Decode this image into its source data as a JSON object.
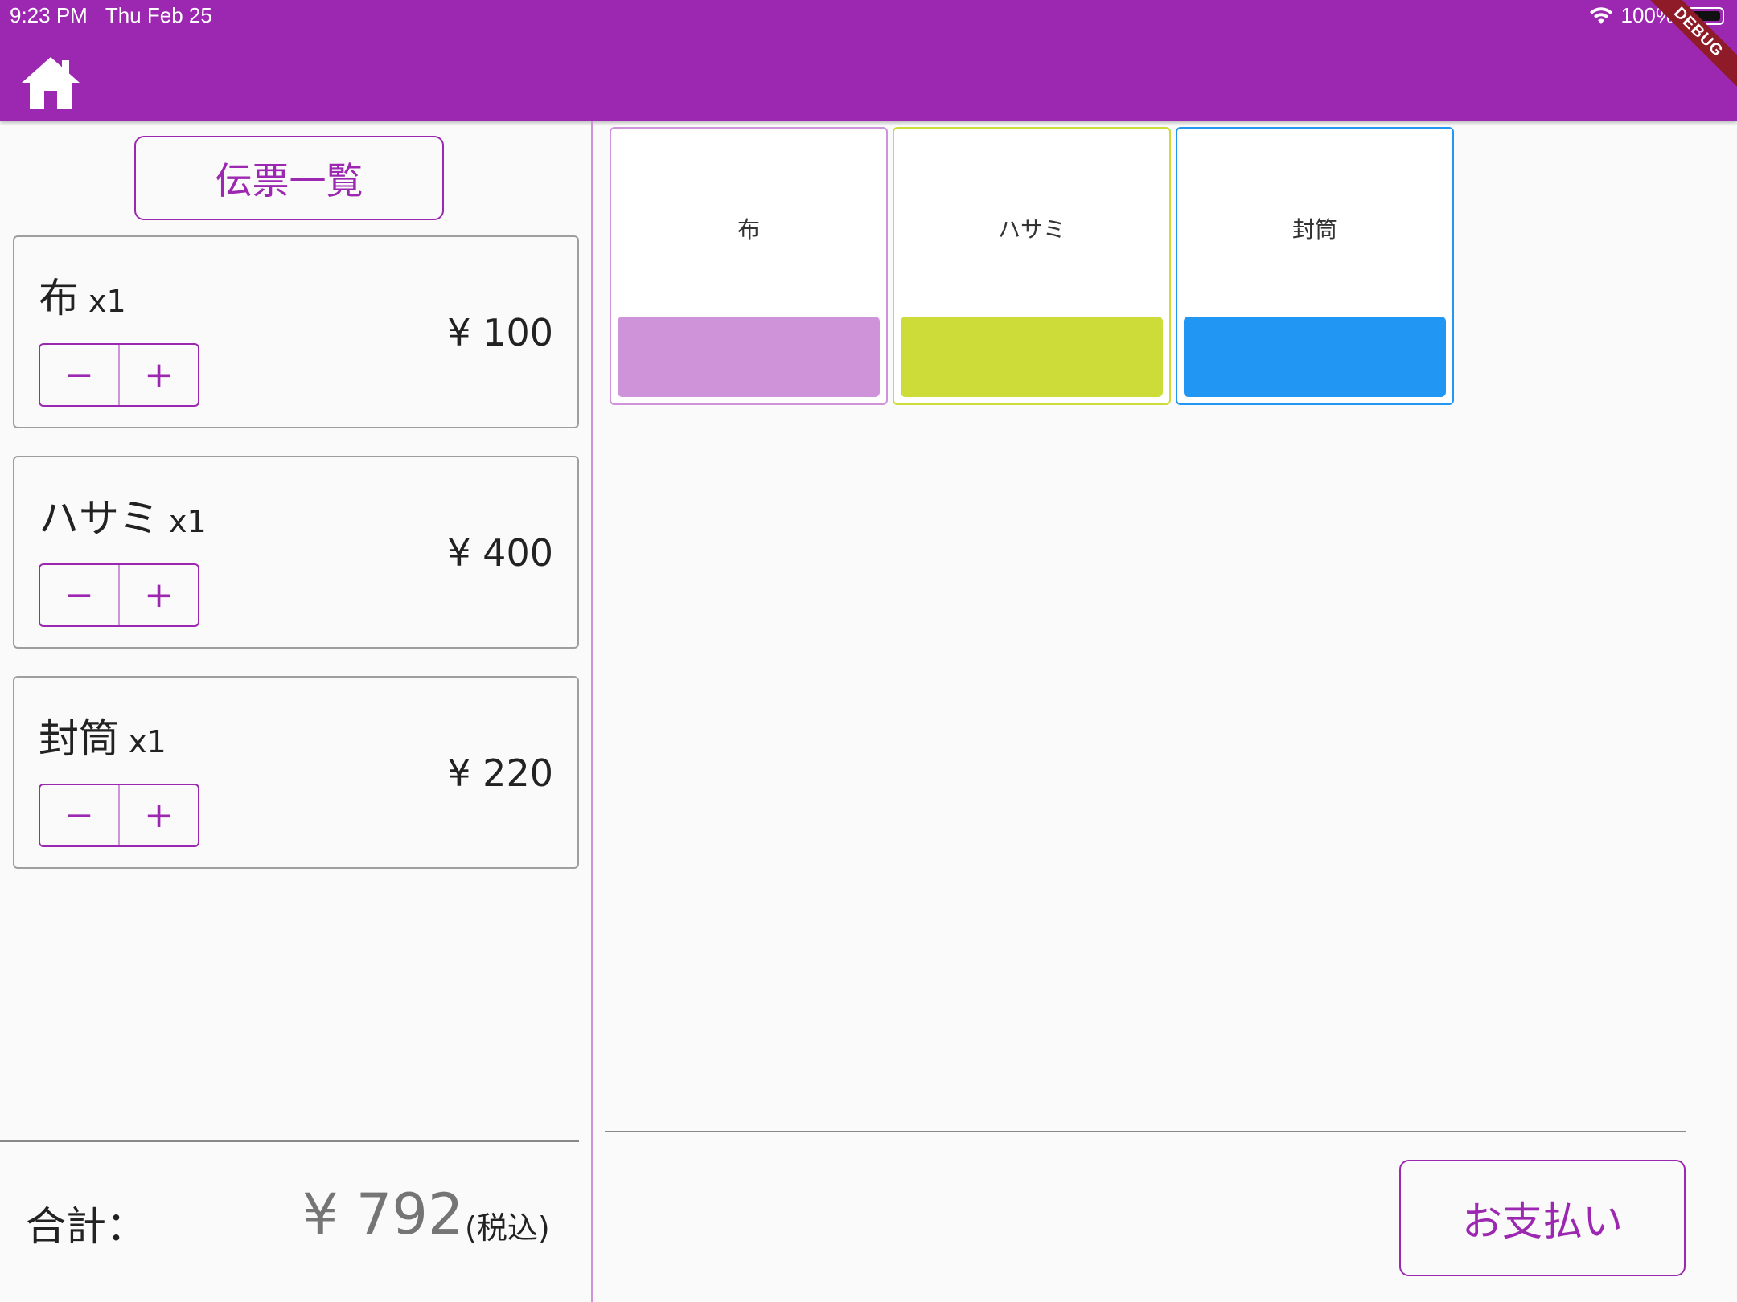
{
  "status_bar": {
    "time": "9:23 PM",
    "date": "Thu Feb 25",
    "battery": "100%"
  },
  "debug_label": "DEBUG",
  "app_bar": {
    "home_icon": "home-icon"
  },
  "left": {
    "slip_list_label": "伝票一覧",
    "cart": [
      {
        "name": "布",
        "qty": "x1",
        "price": "¥ 100",
        "minus": "−",
        "plus": "+"
      },
      {
        "name": "ハサミ",
        "qty": "x1",
        "price": "¥ 400",
        "minus": "−",
        "plus": "+"
      },
      {
        "name": "封筒",
        "qty": "x1",
        "price": "¥ 220",
        "minus": "−",
        "plus": "+"
      }
    ],
    "total_label": "合計：",
    "total_amount": "¥ 792",
    "tax_note": "(税込)"
  },
  "products": [
    {
      "name": "布",
      "color": "#ce93d8"
    },
    {
      "name": "ハサミ",
      "color": "#cddc39"
    },
    {
      "name": "封筒",
      "color": "#2196f3"
    }
  ],
  "pay_label": "お支払い",
  "colors": {
    "primary": "#9c27b0"
  }
}
